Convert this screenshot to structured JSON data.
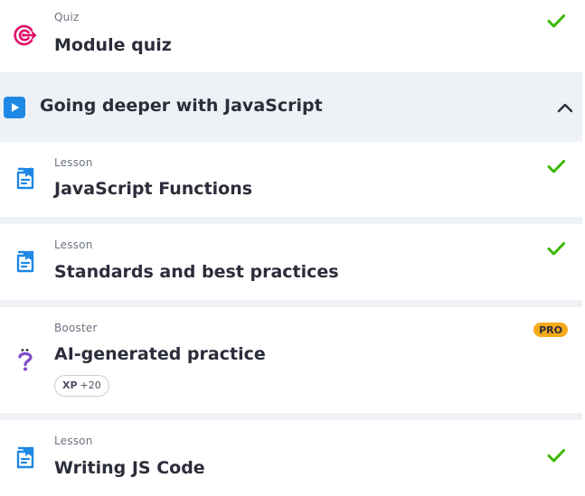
{
  "colors": {
    "accent_blue": "#1e88e5",
    "check_green": "#3bb800",
    "quiz_pink": "#e0126b",
    "booster_purple": "#7c4dcc",
    "pro_orange": "#f4a91a",
    "background": "#eef1f5"
  },
  "items_before": [
    {
      "type": "Quiz",
      "title": "Module quiz",
      "icon": "target-icon",
      "completed": true
    }
  ],
  "module": {
    "title": "Going deeper with JavaScript",
    "icon": "play-icon",
    "expanded": true,
    "toggle_icon": "chevron-up-icon"
  },
  "items": [
    {
      "type": "Lesson",
      "title": "JavaScript Functions",
      "icon": "lesson-document-icon",
      "completed": true
    },
    {
      "type": "Lesson",
      "title": "Standards and best practices",
      "icon": "lesson-document-icon",
      "completed": true
    },
    {
      "type": "Booster",
      "title": "AI-generated practice",
      "icon": "question-mark-icon",
      "badge": "PRO",
      "xp_label": "XP",
      "xp_value": "+20",
      "completed": false
    },
    {
      "type": "Lesson",
      "title": "Writing JS Code",
      "icon": "lesson-document-icon",
      "completed": true
    }
  ]
}
